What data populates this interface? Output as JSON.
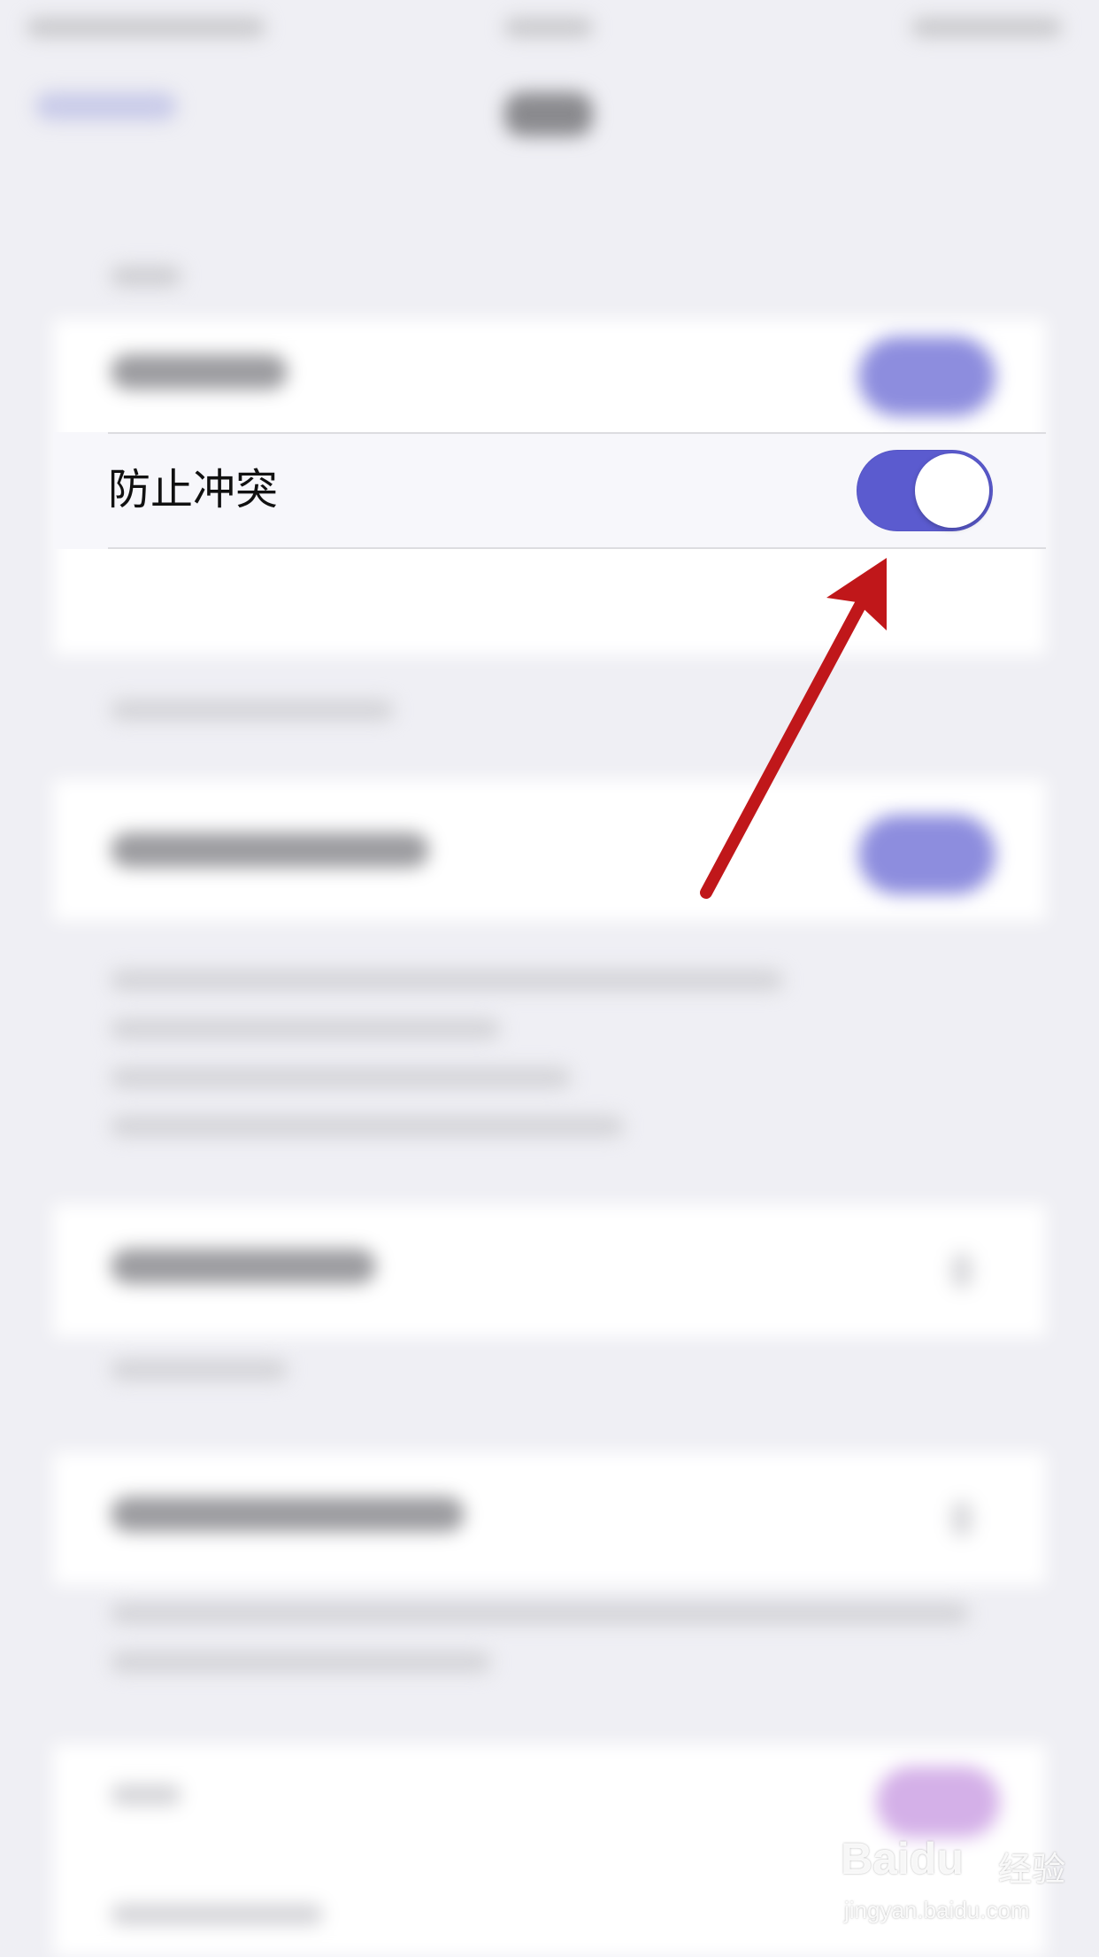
{
  "setting": {
    "label": "防止冲突",
    "toggle_on": true,
    "accent_color": "#5b5bcf"
  },
  "annotation": {
    "arrow_color": "#c0171a",
    "points_to": "toggle-switch"
  },
  "watermark": {
    "brand": "Baidu",
    "brand_cn": "经验",
    "url": "jingyan.baidu.com"
  }
}
